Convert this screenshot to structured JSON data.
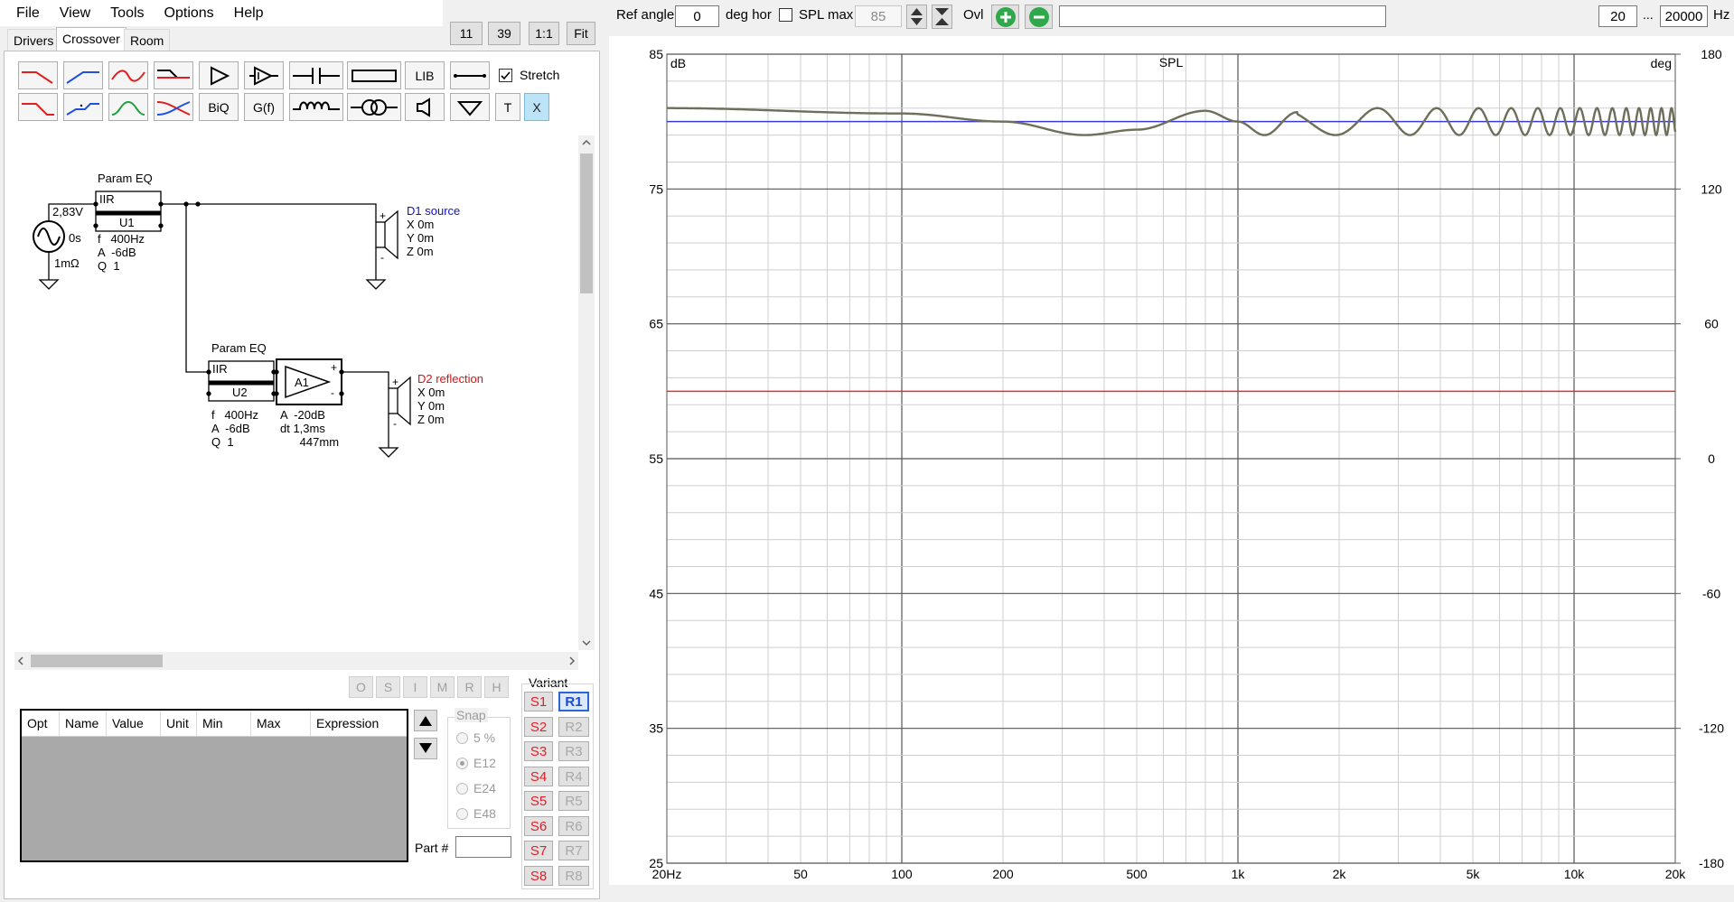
{
  "menu": [
    "File",
    "View",
    "Tools",
    "Options",
    "Help"
  ],
  "zoom_buttons": [
    "11",
    "39",
    "1:1",
    "Fit"
  ],
  "tabs": [
    "Drivers",
    "Crossover",
    "Room"
  ],
  "toolbar": {
    "lib_label": "LIB",
    "biq_label": "BiQ",
    "gf_label": "G(f)",
    "t_label": "T",
    "x_label": "X",
    "stretch_label": "Stretch",
    "stretch_checked": true
  },
  "schematic": {
    "block1": {
      "title": "Param EQ",
      "type": "IIR",
      "id": "U1",
      "params": "f   400Hz\nA  -6dB\nQ  1"
    },
    "source": {
      "voltage": "2,83V",
      "delay": "0s",
      "impedance": "1mΩ"
    },
    "driver1": {
      "name": "D1 source",
      "coords": "X 0m\nY 0m\nZ 0m",
      "color": "#0000cc"
    },
    "block2": {
      "title": "Param EQ",
      "type": "IIR",
      "id": "U2",
      "params": "f   400Hz\nA  -6dB\nQ  1"
    },
    "amp": {
      "id": "A1",
      "params": "A  -20dB\ndt 1,3ms\n      447mm"
    },
    "driver2": {
      "name": "D2 reflection",
      "coords": "X 0m\nY 0m\nZ 0m",
      "color": "#cc0000"
    }
  },
  "small_buttons": [
    "O",
    "S",
    "I",
    "M",
    "R",
    "H"
  ],
  "param_table": {
    "columns": [
      "Opt",
      "Name",
      "Value",
      "Unit",
      "Min",
      "Max",
      "Expression"
    ]
  },
  "snap": {
    "label": "Snap",
    "options": [
      "5 %",
      "E12",
      "E24",
      "E48"
    ],
    "selected": "E12"
  },
  "part_label": "Part #",
  "variant": {
    "label": "Variant",
    "s": [
      "S1",
      "S2",
      "S3",
      "S4",
      "S5",
      "S6",
      "S7",
      "S8"
    ],
    "r": [
      "R1",
      "R2",
      "R3",
      "R4",
      "R5",
      "R6",
      "R7",
      "R8"
    ],
    "active_r": "R1"
  },
  "top_strip": {
    "ref_angle_label": "Ref angle",
    "ref_angle_value": "0",
    "deg_hor_label": "deg hor",
    "spl_max_label": "SPL max",
    "spl_max_value": "85",
    "ovl_label": "Ovl",
    "fmin": "20",
    "ellipsis": "...",
    "fmax": "20000",
    "hz_label": "Hz"
  },
  "chart_data": {
    "type": "line",
    "title": "SPL",
    "ylabel": "dB",
    "y2label": "deg",
    "xscale": "log",
    "xlim": [
      20,
      20000
    ],
    "ylim": [
      25,
      85
    ],
    "y2lim": [
      -180,
      180
    ],
    "x_ticks": [
      "20Hz",
      "50",
      "100",
      "200",
      "500",
      "1k",
      "2k",
      "5k",
      "10k",
      "20k"
    ],
    "x_tick_values": [
      20,
      50,
      100,
      200,
      500,
      1000,
      2000,
      5000,
      10000,
      20000
    ],
    "y_ticks": [
      85,
      75,
      65,
      55,
      45,
      35,
      25
    ],
    "y2_ticks": [
      180,
      120,
      60,
      0,
      -60,
      -120,
      -180
    ],
    "series": [
      {
        "color": "#6e6e5a",
        "description_points": [
          [
            20,
            81.0
          ],
          [
            100,
            80.6
          ],
          [
            200,
            80.0
          ],
          [
            350,
            79.0
          ],
          [
            500,
            79.4
          ],
          [
            800,
            80.8
          ],
          [
            1000,
            80.0
          ],
          [
            1200,
            79.0
          ],
          [
            1500,
            80.7
          ],
          [
            20000,
            80.0
          ]
        ],
        "oscillation_start_hz": 1000,
        "oscillation_amplitude_db": 1.0
      },
      {
        "color": "#3b3bd9",
        "constant": 80.0
      },
      {
        "color": "#e03030",
        "constant": 60.0
      }
    ],
    "grid": true
  }
}
